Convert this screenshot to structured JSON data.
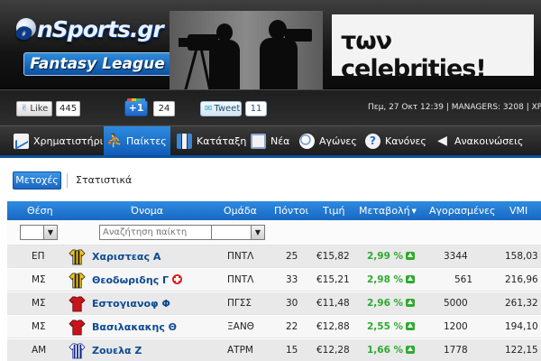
{
  "header": {
    "logo_main": "onSports.gr",
    "logo_sub": "Fantasy League",
    "banner_text": "των celebrities!"
  },
  "social": {
    "like_label": "Like",
    "like_count": "445",
    "plus_label": "+1",
    "plus_count": "24",
    "tweet_label": "Tweet",
    "tweet_count": "11",
    "meta": "Πεμ, 27 Οκτ 12:39  |  MANAGERS: 3208  |  ΧΡ"
  },
  "nav": {
    "items": [
      {
        "label": "Χρηματιστήριο",
        "icon": "chart-icon"
      },
      {
        "label": "Παίκτες",
        "icon": "player-icon",
        "active": true
      },
      {
        "label": "Κατάταξη",
        "icon": "ranking-icon"
      },
      {
        "label": "Νέα",
        "icon": "news-icon"
      },
      {
        "label": "Αγώνες",
        "icon": "ball-icon"
      },
      {
        "label": "Κανόνες",
        "icon": "help-icon"
      },
      {
        "label": "Ανακοινώσεις",
        "icon": "speaker-icon"
      }
    ]
  },
  "subtabs": {
    "active": "Μετοχές",
    "other": "Στατιστικά"
  },
  "table": {
    "headers": {
      "position": "Θέση",
      "name": "Όνομα",
      "team": "Ομάδα",
      "points": "Πόντοι",
      "price": "Τιμή",
      "change": "Μεταβολή",
      "bought": "Αγορασμένες",
      "vmi": "VMI"
    },
    "search_placeholder": "Αναζήτηση παίκτη",
    "rows": [
      {
        "position": "ΕΠ",
        "name": "Χαριστεας Α",
        "team": "ΠΝΤΛ",
        "points": "25",
        "price": "€15,82",
        "change": "2,99 %",
        "bought": "3344",
        "vmi": "158,03",
        "jersey": "aek"
      },
      {
        "position": "ΜΣ",
        "name": "Θεοδωριδης Γ",
        "team": "ΠΝΤΛ",
        "points": "33",
        "price": "€15,21",
        "change": "2,98 %",
        "bought": "561",
        "vmi": "216,96",
        "jersey": "aek",
        "flag": "swiss"
      },
      {
        "position": "ΜΣ",
        "name": "Εστογιανοφ Φ",
        "team": "ΠΓΣΣ",
        "points": "30",
        "price": "€11,48",
        "change": "2,96 %",
        "bought": "5000",
        "vmi": "261,32",
        "jersey": "red"
      },
      {
        "position": "ΜΣ",
        "name": "Βασιλακακης Θ",
        "team": "ΞΑΝΘ",
        "points": "22",
        "price": "€12,88",
        "change": "2,55 %",
        "bought": "1200",
        "vmi": "194,10",
        "jersey": "red"
      },
      {
        "position": "ΑΜ",
        "name": "Ζουελα Ζ",
        "team": "ΑΤΡΜ",
        "points": "15",
        "price": "€12,28",
        "change": "1,66 %",
        "bought": "1778",
        "vmi": "122,15",
        "jersey": "blue"
      }
    ]
  },
  "colors": {
    "accent_blue": "#1868c4",
    "change_green": "#2eaa2e",
    "name_blue": "#0d4a93"
  }
}
